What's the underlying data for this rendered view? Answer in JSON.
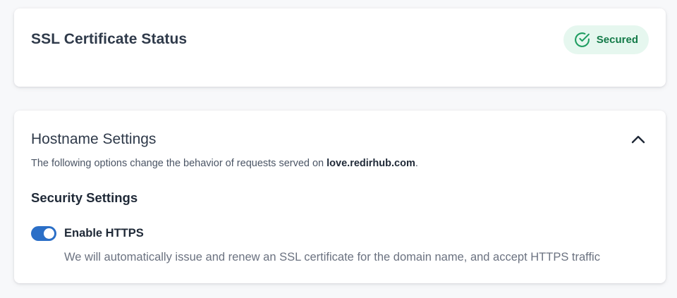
{
  "ssl_card": {
    "title": "SSL Certificate Status",
    "badge_label": "Secured",
    "badge_icon": "check-circle-icon",
    "badge_color": "#137a48",
    "badge_bg": "#e6f7ef"
  },
  "hostname_card": {
    "title": "Hostname Settings",
    "collapse_icon": "chevron-up-icon",
    "description_prefix": "The following options change the behavior of requests served on ",
    "hostname": "love.redirhub.com",
    "description_suffix": ".",
    "security": {
      "title": "Security Settings",
      "https_toggle": {
        "label": "Enable HTTPS",
        "enabled": true,
        "help": "We will automatically issue and renew an SSL certificate for the domain name, and accept HTTPS traffic",
        "accent": "#2b6fc7"
      }
    }
  }
}
